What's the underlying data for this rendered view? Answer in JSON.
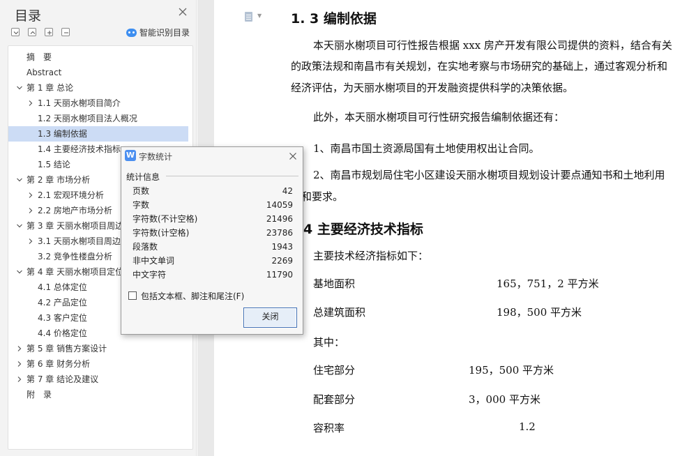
{
  "toc": {
    "title": "目录",
    "smart_detect_label": "智能识别目录",
    "items": [
      {
        "label": "摘　要",
        "level": 0,
        "expander": false
      },
      {
        "label": "Abstract",
        "level": 0,
        "expander": false
      },
      {
        "label": "第 1 章  总论",
        "level": 0,
        "expander": "open"
      },
      {
        "label": "1.1  天丽水榭项目简介",
        "level": 1,
        "expander": "closed"
      },
      {
        "label": "1.2 天丽水榭项目法人概况",
        "level": 1,
        "expander": false
      },
      {
        "label": "1.3 编制依据",
        "level": 1,
        "expander": false,
        "selected": true
      },
      {
        "label": "1.4 主要经济技术指标",
        "level": 1,
        "expander": false
      },
      {
        "label": "1.5 结论",
        "level": 1,
        "expander": false
      },
      {
        "label": "第 2 章  市场分析",
        "level": 0,
        "expander": "open"
      },
      {
        "label": "2.1  宏观环境分析",
        "level": 1,
        "expander": "closed"
      },
      {
        "label": "2.2  房地产市场分析",
        "level": 1,
        "expander": "closed"
      },
      {
        "label": "第 3 章  天丽水榭项目周边",
        "level": 0,
        "expander": "open"
      },
      {
        "label": "3.1  天丽水榭项目周边",
        "level": 1,
        "expander": "closed"
      },
      {
        "label": "3.2  竞争性楼盘分析",
        "level": 1,
        "expander": false
      },
      {
        "label": "第 4 章  天丽水榭项目定位",
        "level": 0,
        "expander": "open"
      },
      {
        "label": "4.1  总体定位",
        "level": 1,
        "expander": false
      },
      {
        "label": "4.2  产品定位",
        "level": 1,
        "expander": false
      },
      {
        "label": "4.3  客户定位",
        "level": 1,
        "expander": false
      },
      {
        "label": "4.4  价格定位",
        "level": 1,
        "expander": false
      },
      {
        "label": "第 5 章  销售方案设计",
        "level": 0,
        "expander": "closed"
      },
      {
        "label": "第 6 章  财务分析",
        "level": 0,
        "expander": "closed"
      },
      {
        "label": "第 7 章  结论及建议",
        "level": 0,
        "expander": "closed"
      },
      {
        "label": "附　录",
        "level": 0,
        "expander": false
      }
    ]
  },
  "document": {
    "heading_1": "1. 3 编制依据",
    "para_1_line_1": "本天丽水榭项目可行性报告根据 xxx 房产开发有限公司提供的资料，结合有关",
    "para_1_line_2": "的政策法规和南昌市有关规划，在实地考察与市场研究的基础上，通过客观分析和",
    "para_1_line_3": "经济评估，为天丽水榭项目的开发融资提供科学的决策依据。",
    "para_2": "此外，本天丽水榭项目可行性研究报告编制依据还有：",
    "item_1": "1、南昌市国土资源局国有土地使用权出让合同。",
    "item_2_line_1": "2、南昌市规划局住宅小区建设天丽水榭项目规划设计要点通知书和土地利用",
    "item_2_line_2": "件和要求。",
    "heading_2": "4 主要经济技术指标",
    "intro": "主要技术经济指标如下：",
    "indicators": [
      {
        "label": "基地面积",
        "value": "165，751，2 平方米"
      },
      {
        "label": "总建筑面积",
        "value": "198，500 平方米"
      },
      {
        "label": "其中：",
        "value": ""
      },
      {
        "label": "住宅部分",
        "value": "195，500 平方米"
      },
      {
        "label": "配套部分",
        "value": "3，000 平方米"
      },
      {
        "label": "容积率",
        "value": "1.2"
      }
    ]
  },
  "dialog": {
    "title": "字数统计",
    "logo_letter": "W",
    "section_label": "统计信息",
    "stats": [
      {
        "label": "页数",
        "value": "42"
      },
      {
        "label": "字数",
        "value": "14059"
      },
      {
        "label": "字符数(不计空格)",
        "value": "21496"
      },
      {
        "label": "字符数(计空格)",
        "value": "23786"
      },
      {
        "label": "段落数",
        "value": "1943"
      },
      {
        "label": "非中文单词",
        "value": "2269"
      },
      {
        "label": "中文字符",
        "value": "11790"
      }
    ],
    "checkbox_label": "包括文本框、脚注和尾注(F)",
    "checkbox_checked": false,
    "close_label": "关闭"
  },
  "colors": {
    "selection": "#ccdcf5",
    "accent": "#4b8ff0"
  }
}
